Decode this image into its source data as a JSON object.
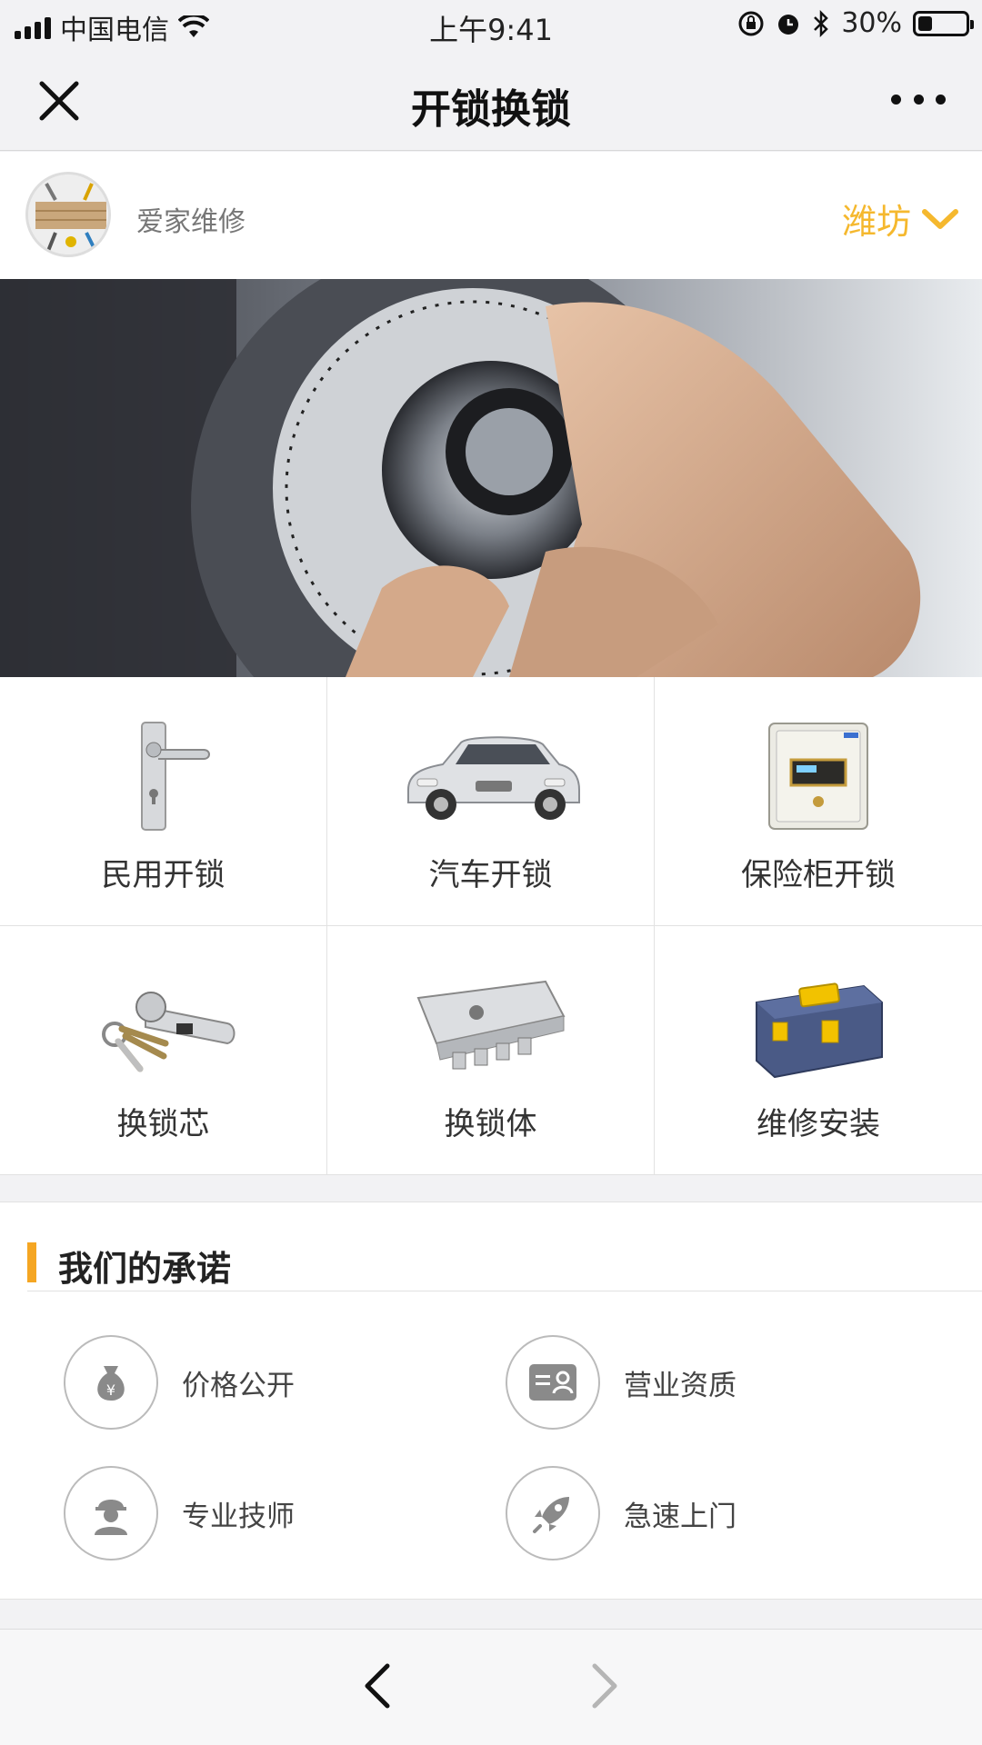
{
  "status_bar": {
    "carrier": "中国电信",
    "time": "上午9:41",
    "battery_percent": "30%",
    "battery_level": 0.3,
    "icons": [
      "signal-icon",
      "wifi-icon",
      "orientation-lock-icon",
      "alarm-icon",
      "bluetooth-icon",
      "battery-icon"
    ]
  },
  "nav": {
    "title": "开锁换锁",
    "close_icon": "close-icon",
    "more_icon": "more-icon"
  },
  "shop": {
    "name": "爱家维修",
    "city": "潍坊"
  },
  "services": [
    {
      "label": "民用开锁",
      "icon": "door-handle-lock-image"
    },
    {
      "label": "汽车开锁",
      "icon": "car-image"
    },
    {
      "label": "保险柜开锁",
      "icon": "safe-image"
    },
    {
      "label": "换锁芯",
      "icon": "lock-cylinder-keys-image"
    },
    {
      "label": "换锁体",
      "icon": "mortise-lock-body-image"
    },
    {
      "label": "维修安装",
      "icon": "toolbox-image"
    }
  ],
  "promise": {
    "title": "我们的承诺",
    "accent_color": "#f5a623",
    "items": [
      {
        "label": "价格公开",
        "icon": "money-bag-icon"
      },
      {
        "label": "营业资质",
        "icon": "id-card-icon"
      },
      {
        "label": "专业技师",
        "icon": "technician-icon"
      },
      {
        "label": "急速上门",
        "icon": "rocket-icon"
      }
    ]
  },
  "colors": {
    "city_accent": "#f5b82e",
    "background": "#f2f2f4"
  }
}
